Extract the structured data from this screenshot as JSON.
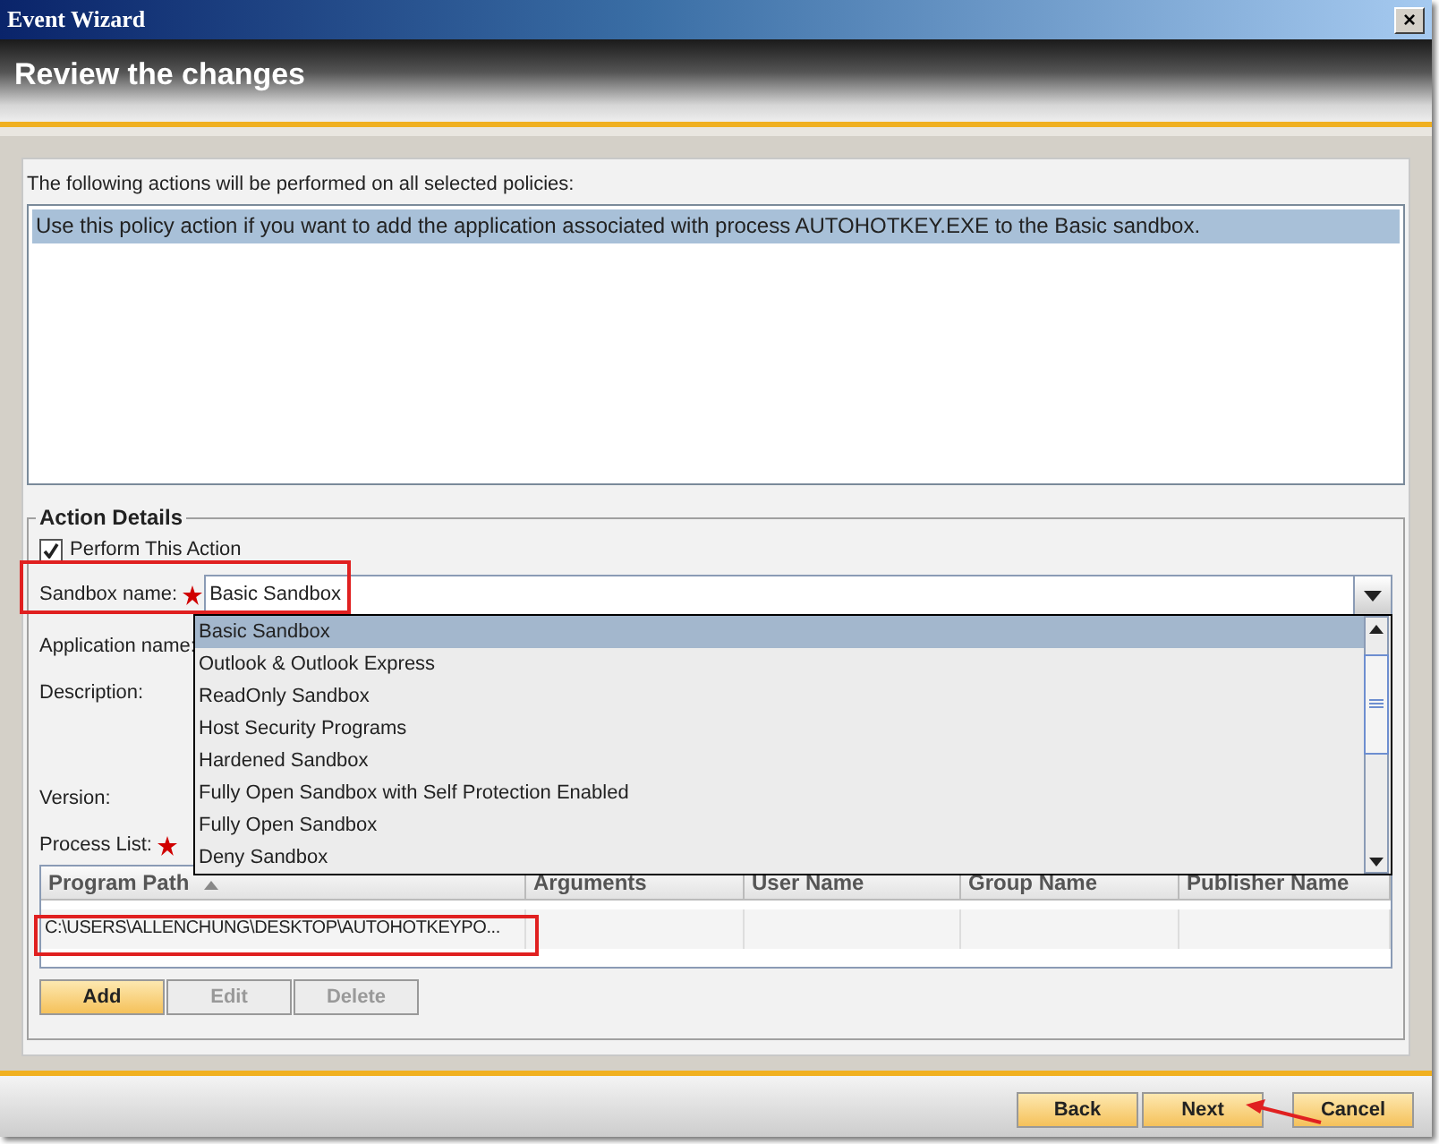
{
  "window": {
    "title": "Event Wizard",
    "close": "×"
  },
  "header": {
    "title": "Review the changes"
  },
  "intro": "The following actions will be performed on all selected policies:",
  "actions": [
    {
      "text": "Use this policy action if you want to add the application associated with process AUTOHOTKEY.EXE to the Basic sandbox.",
      "selected": true
    }
  ],
  "action_details": {
    "legend": "Action Details",
    "perform": {
      "label": "Perform This Action",
      "checked": true
    },
    "fields": [
      {
        "label": "Sandbox name:",
        "required": true,
        "kind": "combo",
        "value": "Basic Sandbox"
      },
      {
        "label": "Application name:",
        "required": false,
        "kind": "plain"
      },
      {
        "label": "Description:",
        "required": false,
        "kind": "tall"
      },
      {
        "label": "Version:",
        "required": false,
        "kind": "plain"
      },
      {
        "label": "Process List:",
        "required": true,
        "kind": "plain"
      }
    ],
    "dropdown": [
      {
        "label": "Basic Sandbox",
        "selected": true
      },
      {
        "label": "Outlook & Outlook Express",
        "selected": false
      },
      {
        "label": "ReadOnly Sandbox",
        "selected": false
      },
      {
        "label": "Host Security Programs",
        "selected": false
      },
      {
        "label": "Hardened Sandbox",
        "selected": false
      },
      {
        "label": "Fully Open Sandbox with Self Protection Enabled",
        "selected": false
      },
      {
        "label": "Fully Open Sandbox",
        "selected": false
      },
      {
        "label": "Deny Sandbox",
        "selected": false
      }
    ],
    "table": {
      "columns": [
        "Program Path",
        "Arguments",
        "User Name",
        "Group Name",
        "Publisher Name"
      ],
      "rows": [
        {
          "cells": [
            "C:\\USERS\\ALLENCHUNG\\DESKTOP\\AUTOHOTKEYPO...",
            "",
            "",
            "",
            ""
          ]
        }
      ]
    },
    "buttons": [
      {
        "label": "Add",
        "disabled": false
      },
      {
        "label": "Edit",
        "disabled": true
      },
      {
        "label": "Delete",
        "disabled": true
      }
    ]
  },
  "footer_buttons": [
    {
      "label": "Back"
    },
    {
      "label": "Next"
    },
    {
      "label": "Cancel"
    }
  ]
}
